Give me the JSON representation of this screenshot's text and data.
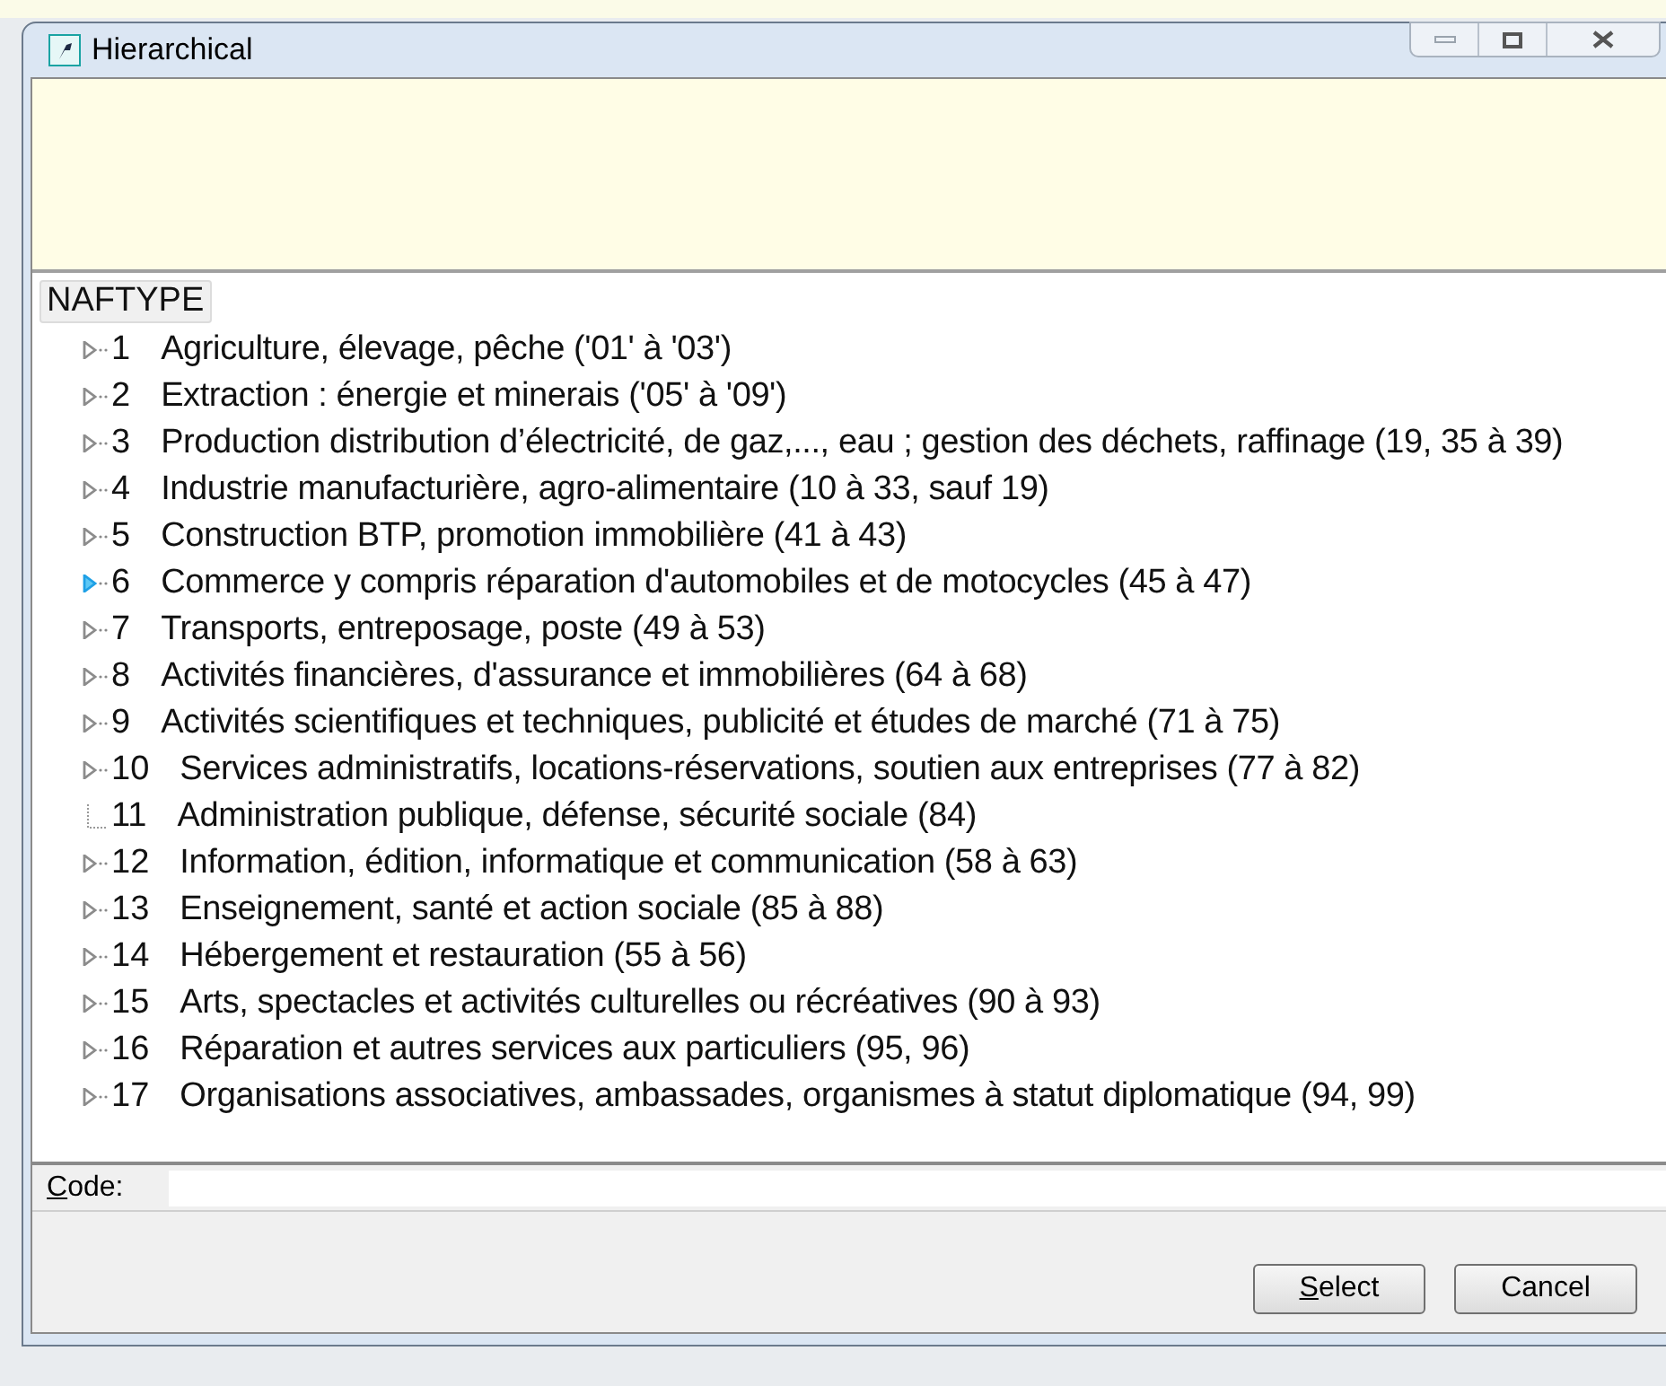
{
  "window": {
    "title": "Hierarchical"
  },
  "tree": {
    "header": "NAFTYPE",
    "items": [
      {
        "kind": "branch",
        "hovered": false,
        "code": "1",
        "label": "Agriculture, élevage, pêche ('01' à '03')"
      },
      {
        "kind": "branch",
        "hovered": false,
        "code": "2",
        "label": "Extraction : énergie et minerais ('05' à '09')"
      },
      {
        "kind": "branch",
        "hovered": false,
        "code": "3",
        "label": "Production distribution d’électricité, de gaz,..., eau ; gestion des déchets, raffinage (19, 35 à 39)"
      },
      {
        "kind": "branch",
        "hovered": false,
        "code": "4",
        "label": "Industrie manufacturière, agro-alimentaire (10 à 33, sauf 19)"
      },
      {
        "kind": "branch",
        "hovered": false,
        "code": "5",
        "label": "Construction BTP, promotion immobilière (41 à 43)"
      },
      {
        "kind": "branch",
        "hovered": true,
        "code": "6",
        "label": "Commerce y compris réparation d'automobiles et de motocycles (45 à 47)"
      },
      {
        "kind": "branch",
        "hovered": false,
        "code": "7",
        "label": "Transports, entreposage, poste (49 à 53)"
      },
      {
        "kind": "branch",
        "hovered": false,
        "code": "8",
        "label": "Activités financières, d'assurance et immobilières (64 à 68)"
      },
      {
        "kind": "branch",
        "hovered": false,
        "code": "9",
        "label": "Activités scientifiques et techniques, publicité et études de marché (71 à 75)"
      },
      {
        "kind": "branch",
        "hovered": false,
        "code": "10",
        "label": "Services administratifs, locations-réservations, soutien aux entreprises (77 à 82)"
      },
      {
        "kind": "leaf",
        "code": "11",
        "label": "Administration publique, défense, sécurité sociale (84)"
      },
      {
        "kind": "branch",
        "hovered": false,
        "code": "12",
        "label": "Information, édition, informatique et communication (58 à 63)"
      },
      {
        "kind": "branch",
        "hovered": false,
        "code": "13",
        "label": "Enseignement, santé et action sociale (85 à 88)"
      },
      {
        "kind": "branch",
        "hovered": false,
        "code": "14",
        "label": "Hébergement et restauration (55 à 56)"
      },
      {
        "kind": "branch",
        "hovered": false,
        "code": "15",
        "label": "Arts, spectacles et activités culturelles ou récréatives (90 à 93)"
      },
      {
        "kind": "branch",
        "hovered": false,
        "code": "16",
        "label": "Réparation et autres services aux particuliers (95, 96)"
      },
      {
        "kind": "branch",
        "hovered": false,
        "code": "17",
        "label": "Organisations associatives, ambassades, organismes à statut diplomatique (94, 99)"
      }
    ]
  },
  "code_field": {
    "label": "Code:"
  },
  "buttons": [
    {
      "label": "Select"
    },
    {
      "label": "Cancel"
    }
  ]
}
